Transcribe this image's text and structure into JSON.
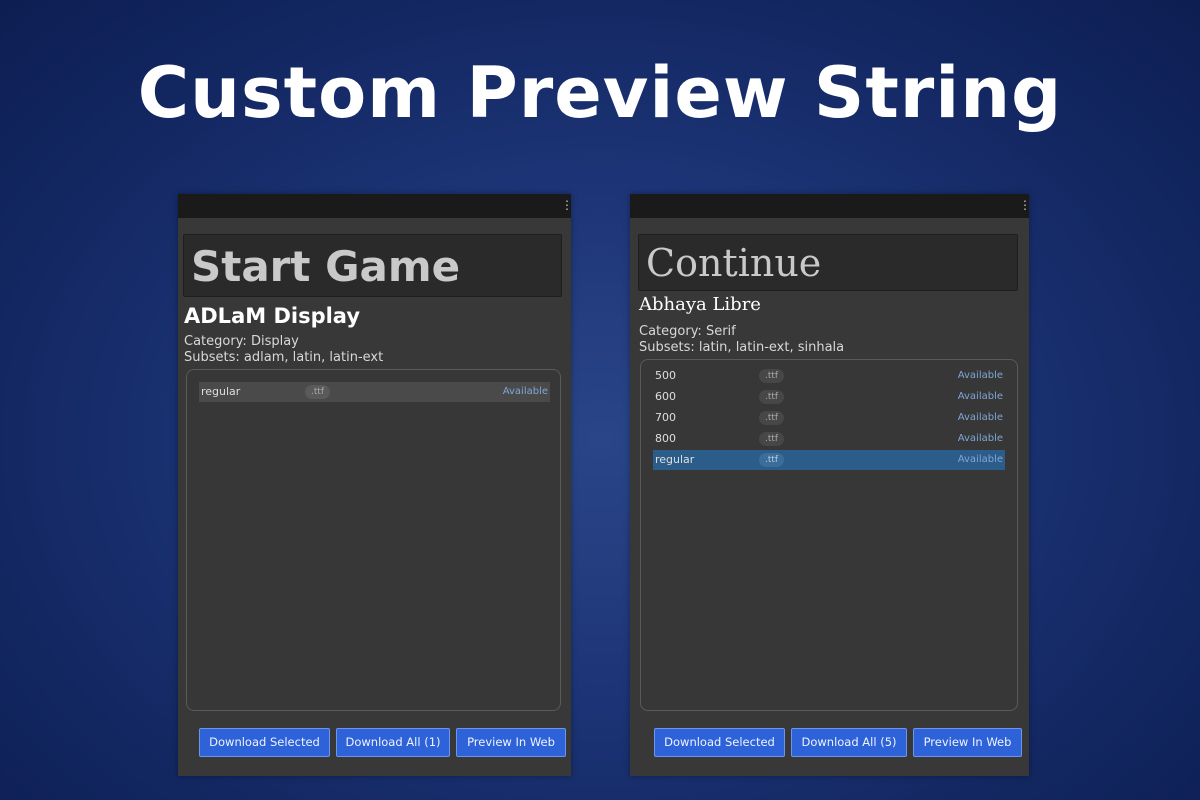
{
  "headline": "Custom Preview String",
  "panels": {
    "left": {
      "preview_text": "Start Game",
      "font_name": "ADLaM Display",
      "category": "Category: Display",
      "subsets": "Subsets: adlam, latin, latin-ext",
      "rows": [
        {
          "variant": "regular",
          "ext": ".ttf",
          "status": "Available"
        }
      ],
      "buttons": {
        "download_selected": "Download Selected",
        "download_all": "Download All (1)",
        "preview_web": "Preview In Web"
      }
    },
    "right": {
      "preview_text": "Continue",
      "font_name": "Abhaya Libre",
      "category": "Category: Serif",
      "subsets": "Subsets: latin, latin-ext, sinhala",
      "rows": [
        {
          "variant": "500",
          "ext": ".ttf",
          "status": "Available"
        },
        {
          "variant": "600",
          "ext": ".ttf",
          "status": "Available"
        },
        {
          "variant": "700",
          "ext": ".ttf",
          "status": "Available"
        },
        {
          "variant": "800",
          "ext": ".ttf",
          "status": "Available"
        },
        {
          "variant": "regular",
          "ext": ".ttf",
          "status": "Available",
          "selected": true
        }
      ],
      "buttons": {
        "download_selected": "Download Selected",
        "download_all": "Download All (5)",
        "preview_web": "Preview In Web"
      }
    }
  },
  "icons": {
    "menu": "kebab-menu-icon"
  },
  "colors": {
    "button_bg": "#2e62d8",
    "selected_row": "#2c5d8a",
    "status_text": "#7fa6d6",
    "panel_bg": "#383838"
  }
}
